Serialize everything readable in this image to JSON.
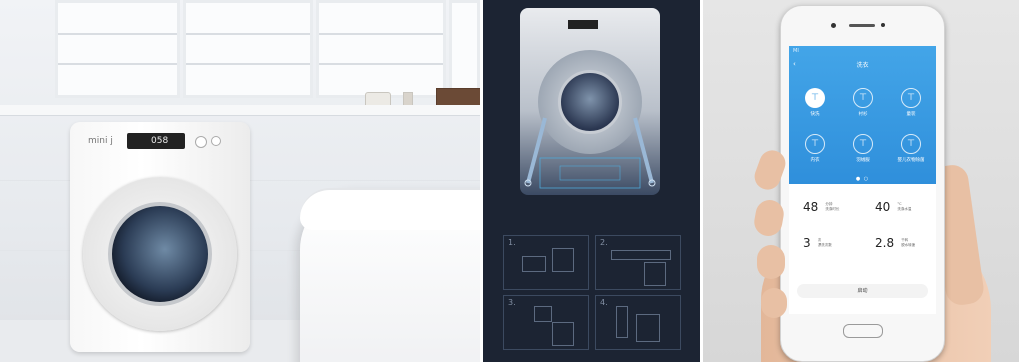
{
  "panels": [
    {
      "washer": {
        "brand": "mini j",
        "display_value": "058"
      }
    },
    {
      "steps": [
        "1.",
        "2.",
        "3.",
        "4."
      ]
    },
    {
      "app": {
        "status_left": "MI",
        "back_icon": "back-arrow-icon",
        "title": "洗衣",
        "modes": [
          {
            "label": "快洗",
            "icon": "shirt-icon",
            "selected": true
          },
          {
            "label": "衬衫",
            "icon": "shirt-icon",
            "selected": false
          },
          {
            "label": "童装",
            "icon": "shirt-icon",
            "selected": false
          },
          {
            "label": "内衣",
            "icon": "shirt-icon",
            "selected": false
          },
          {
            "label": "羽绒服",
            "icon": "shirt-icon",
            "selected": false
          },
          {
            "label": "婴儿衣物除菌",
            "icon": "shirt-icon",
            "selected": false
          }
        ],
        "page_dots": "● ○",
        "stats": [
          {
            "value": "48",
            "unit": "分钟",
            "label": "洗涤时长"
          },
          {
            "value": "40",
            "unit": "°C",
            "label": "洗涤水温"
          },
          {
            "value": "3",
            "unit": "次",
            "label": "漂洗次数"
          },
          {
            "value": "2.8",
            "unit": "千转",
            "label": "脱水转速"
          }
        ],
        "start_label": "启动"
      }
    }
  ],
  "colors": {
    "app_blue": "#3a9be3",
    "blueprint_bg": "#1c2433",
    "blueprint_line": "#4fa8d8"
  }
}
